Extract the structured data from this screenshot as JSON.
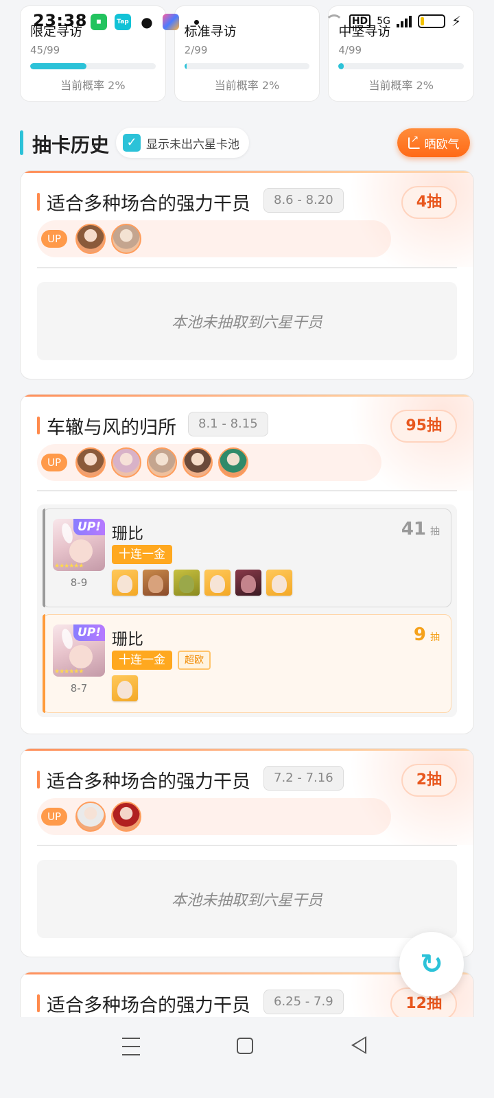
{
  "status_bar": {
    "time": "23:38",
    "network": "5G",
    "hd": "HD",
    "app_icons": [
      "wechat-green-icon",
      "tap-icon",
      "wechat-icon",
      "photos-icon"
    ],
    "tap_label": "Tap"
  },
  "stats": [
    {
      "title": "限定寻访",
      "count": "45/99",
      "progress_percent": 45,
      "rate": "当前概率 2%"
    },
    {
      "title": "标准寻访",
      "count": "2/99",
      "progress_percent": 2,
      "rate": "当前概率 2%"
    },
    {
      "title": "中坚寻访",
      "count": "4/99",
      "progress_percent": 4,
      "rate": "当前概率 2%"
    }
  ],
  "history": {
    "title": "抽卡历史",
    "show_no_six_star_label": "显示未出六星卡池",
    "show_no_six_star_checked": true,
    "share_label": "晒欧气"
  },
  "pools": [
    {
      "name": "适合多种场合的强力干员",
      "date": "8.6 - 8.20",
      "pulls": "4抽",
      "up_label": "UP",
      "empty_text": "本池未抽取到六星干员"
    },
    {
      "name": "车辙与风的归所",
      "date": "8.1 - 8.15",
      "pulls": "95抽",
      "up_label": "UP",
      "records": [
        {
          "operator": "珊比",
          "up_tag": "UP!",
          "stars": "★★★★★★",
          "date": "8-9",
          "tag": "十连一金",
          "pull_count": "41",
          "pull_unit": "抽"
        },
        {
          "operator": "珊比",
          "up_tag": "UP!",
          "stars": "★★★★★★",
          "date": "8-7",
          "tag": "十连一金",
          "extra_tag": "超欧",
          "pull_count": "9",
          "pull_unit": "抽"
        }
      ]
    },
    {
      "name": "适合多种场合的强力干员",
      "date": "7.2 - 7.16",
      "pulls": "2抽",
      "up_label": "UP",
      "empty_text": "本池未抽取到六星干员"
    },
    {
      "name": "适合多种场合的强力干员",
      "date": "6.25 - 7.9",
      "pulls": "12抽"
    }
  ],
  "refresh_icon": "↻",
  "colors": {
    "accent": "#2cc2d8",
    "orange": "#ff6a16",
    "gold_tag": "#ffa81f"
  }
}
